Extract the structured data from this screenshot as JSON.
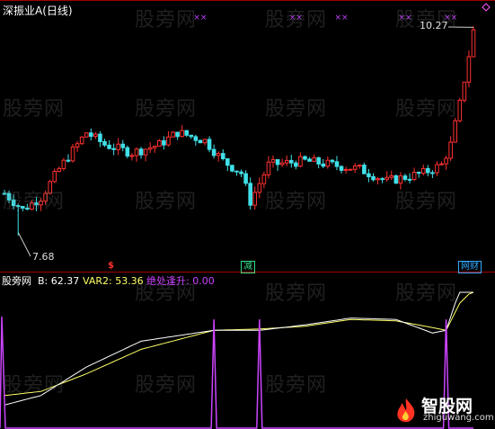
{
  "header": {
    "title": "深振业A(日线)"
  },
  "main_chart": {
    "high_label": "10.27",
    "low_label": "7.68",
    "high_value": 10.27,
    "low_value": 7.68,
    "signals": [
      {
        "text": "$",
        "color": "#ff3030",
        "day": 22
      },
      {
        "text": "减",
        "color": "#33dd88",
        "day": 53
      },
      {
        "text": "网财",
        "color": "#33aaff",
        "day": 101
      }
    ],
    "markers": {
      "symbol": "××",
      "color": "#c040ff",
      "days": [
        43,
        64,
        74,
        88,
        98
      ],
      "diamond_color": "#ff55ff"
    },
    "colors": {
      "up": "#ff3030",
      "down": "#40e0e8",
      "grid": "#a00000"
    }
  },
  "indicator": {
    "name": "股旁网",
    "b_label": "B: 62.37",
    "var2_label": "VAR2: 53.36",
    "signal_label": "绝处逢升: 0.00",
    "b_value": 62.37,
    "var2_value": 53.36,
    "signal_value": 0.0,
    "colors": {
      "b": "#ffffff",
      "var2": "#ffff66",
      "signal": "#cc44ff"
    }
  },
  "watermark": {
    "text": "股旁网"
  },
  "branding": {
    "logo_text": "智股网",
    "logo_sub": "zhiguwang.com"
  },
  "chart_data": {
    "type": "line",
    "title": "深振业A(日线)",
    "price_range": [
      7.68,
      10.27
    ],
    "indicator_range": [
      0,
      100
    ],
    "days": 104,
    "candles_note": "daily candlesticks, range 7.68 – 10.27",
    "series": [
      {
        "name": "B",
        "last": 62.37
      },
      {
        "name": "VAR2",
        "last": 53.36
      },
      {
        "name": "绝处逢升",
        "last": 0.0,
        "spikes_at_days": [
          46,
          56,
          97
        ]
      }
    ]
  }
}
